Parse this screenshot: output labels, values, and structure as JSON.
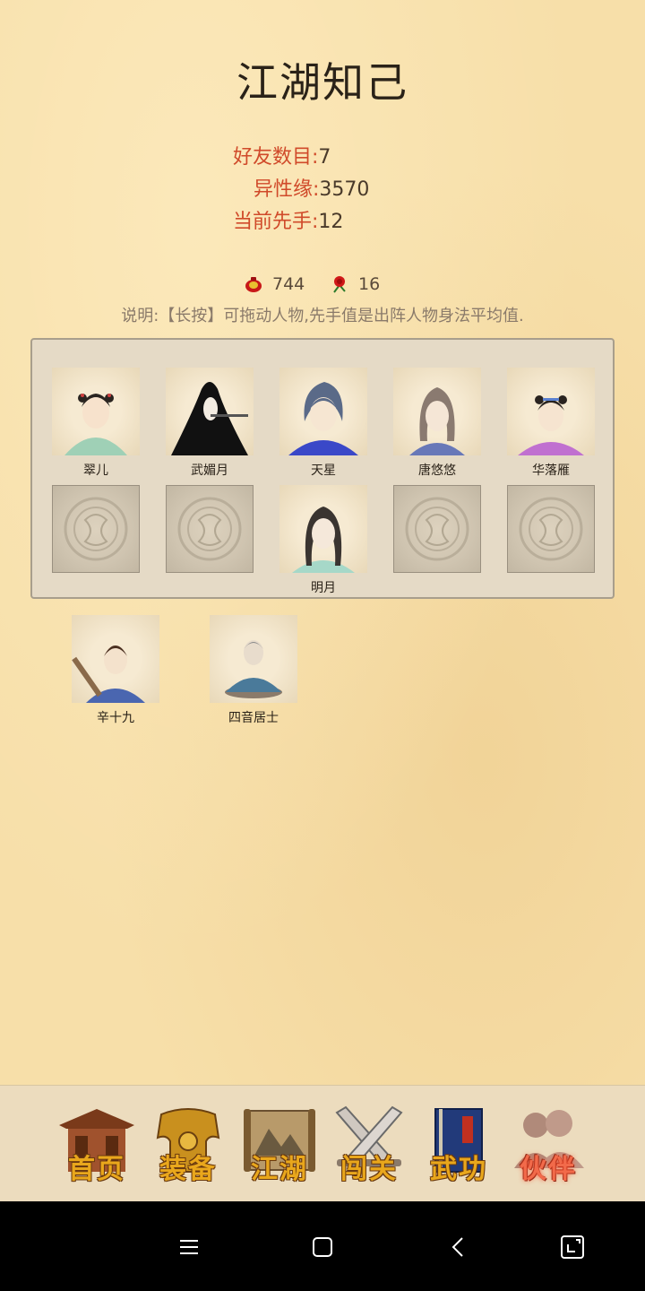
{
  "page": {
    "title": "江湖知己"
  },
  "stats": [
    {
      "label": "好友数目:",
      "value": "7"
    },
    {
      "label": "异性缘:",
      "value": "3570"
    },
    {
      "label": "当前先手:",
      "value": "12"
    }
  ],
  "gifts": [
    {
      "icon": "red-pouch-icon",
      "count": "744"
    },
    {
      "icon": "red-rose-icon",
      "count": "16"
    }
  ],
  "note": "说明:【长按】可拖动人物,先手值是出阵人物身法平均值.",
  "team": {
    "row1": [
      "翠儿",
      "武媚月",
      "天星",
      "唐悠悠",
      "华落雁"
    ],
    "row2": [
      "",
      "",
      "明月",
      "",
      ""
    ]
  },
  "reserve": [
    "辛十九",
    "四音居士"
  ],
  "tabs": [
    {
      "label": "首页",
      "icon": "home-pavilion-icon"
    },
    {
      "label": "装备",
      "icon": "armor-icon"
    },
    {
      "label": "江湖",
      "icon": "scroll-map-icon"
    },
    {
      "label": "闯关",
      "icon": "crossed-swords-icon"
    },
    {
      "label": "武功",
      "icon": "martial-book-icon"
    },
    {
      "label": "伙伴",
      "icon": "companions-icon",
      "active": true
    }
  ],
  "system_nav": [
    "menu-icon",
    "home-square-icon",
    "back-icon",
    "screenshot-icon"
  ]
}
